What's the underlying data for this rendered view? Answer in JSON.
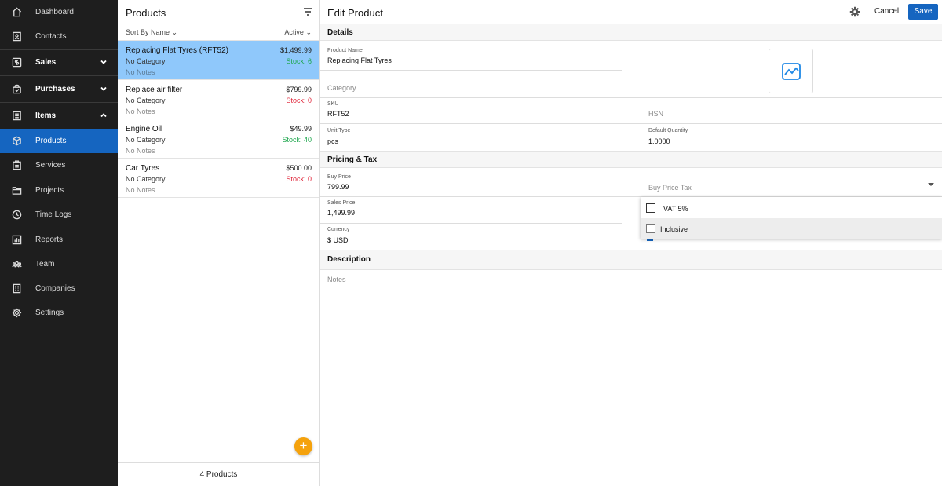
{
  "sidebar": {
    "items": [
      {
        "label": "Dashboard",
        "icon": "home-icon"
      },
      {
        "label": "Contacts",
        "icon": "contacts-icon"
      },
      {
        "label": "Sales",
        "icon": "dollar-icon",
        "expandable": "chevron-down"
      },
      {
        "label": "Purchases",
        "icon": "bag-icon",
        "expandable": "chevron-down"
      },
      {
        "label": "Items",
        "icon": "items-icon",
        "expandable": "chevron-up"
      },
      {
        "label": "Products",
        "icon": "cube-icon",
        "active": true
      },
      {
        "label": "Services",
        "icon": "clipboard-icon"
      },
      {
        "label": "Projects",
        "icon": "folder-icon"
      },
      {
        "label": "Time Logs",
        "icon": "clock-icon"
      },
      {
        "label": "Reports",
        "icon": "chart-icon"
      },
      {
        "label": "Team",
        "icon": "team-icon"
      },
      {
        "label": "Companies",
        "icon": "building-icon"
      },
      {
        "label": "Settings",
        "icon": "gear-icon"
      }
    ]
  },
  "list": {
    "title": "Products",
    "sort_label": "Sort By Name",
    "filter_label": "Active",
    "footer": "4 Products",
    "add_button": "+",
    "products": [
      {
        "name": "Replacing Flat Tyres (RFT52)",
        "category": "No Category",
        "notes": "No Notes",
        "price": "$1,499.99",
        "stock": "Stock: 6",
        "stock_color": "#1ca64c",
        "selected": true
      },
      {
        "name": "Replace air filter",
        "category": "No Category",
        "notes": "No Notes",
        "price": "$799.99",
        "stock": "Stock: 0",
        "stock_color": "#e0263a"
      },
      {
        "name": "Engine Oil",
        "category": "No Category",
        "notes": "No Notes",
        "price": "$49.99",
        "stock": "Stock: 40",
        "stock_color": "#1ca64c"
      },
      {
        "name": "Car Tyres",
        "category": "No Category",
        "notes": "No Notes",
        "price": "$500.00",
        "stock": "Stock: 0",
        "stock_color": "#e0263a"
      }
    ]
  },
  "edit": {
    "title": "Edit Product",
    "cancel": "Cancel",
    "save": "Save",
    "sections": {
      "details": "Details",
      "pricing": "Pricing & Tax",
      "description": "Description"
    },
    "fields": {
      "product_name_label": "Product Name",
      "product_name_value": "Replacing Flat Tyres",
      "category_placeholder": "Category",
      "sku_label": "SKU",
      "sku_value": "RFT52",
      "hsn_placeholder": "HSN",
      "unit_type_label": "Unit Type",
      "unit_type_value": "pcs",
      "default_qty_label": "Default Quantity",
      "default_qty_value": "1.0000",
      "buy_price_label": "Buy Price",
      "buy_price_value": "799.99",
      "buy_price_tax_placeholder": "Buy Price Tax",
      "sales_price_label": "Sales Price",
      "sales_price_value": "1,499.99",
      "currency_label": "Currency",
      "currency_value": "$ USD",
      "notes_placeholder": "Notes"
    },
    "tax_dropdown": {
      "options": [
        {
          "label": "VAT 5%",
          "checked": false
        },
        {
          "label": "Inclusive",
          "checked": false
        }
      ]
    }
  },
  "colors": {
    "sidebar_bg": "#1e1e1e",
    "accent": "#1565c0",
    "selected_row": "#8fc8fb",
    "fab": "#f5a20c",
    "stock_in": "#1ca64c",
    "stock_out": "#e0263a"
  }
}
